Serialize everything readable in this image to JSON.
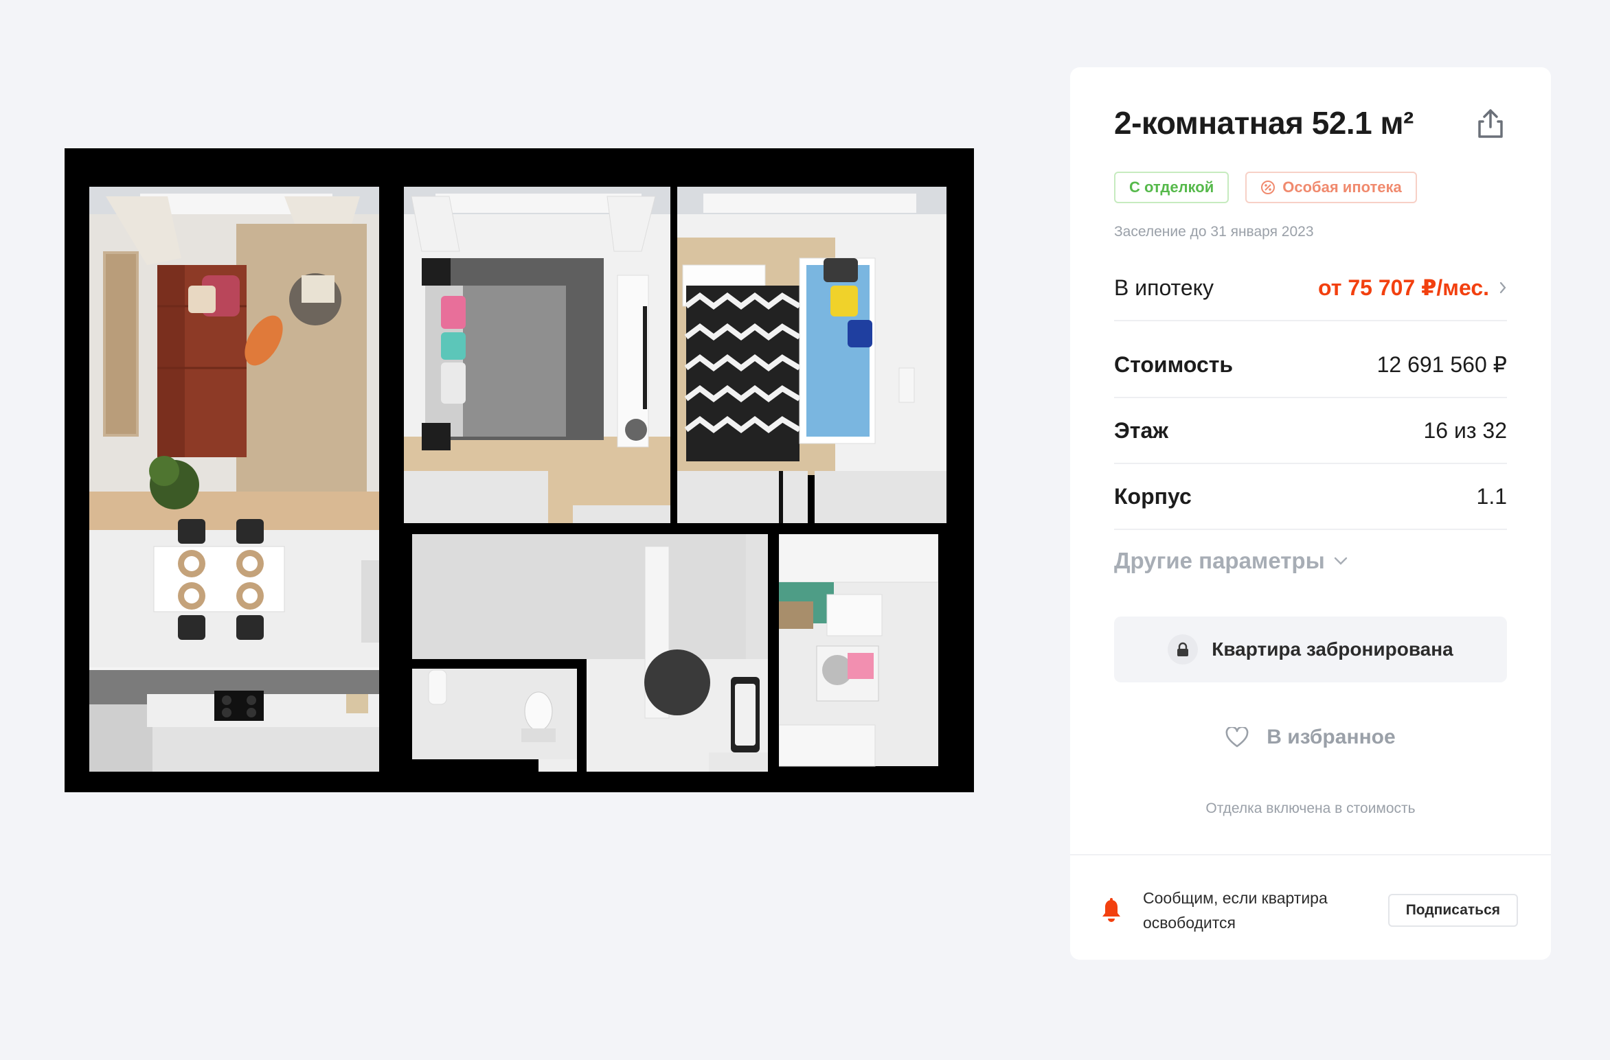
{
  "listing": {
    "title": "2-комнатная 52.1 м²",
    "tags": [
      {
        "label": "С отделкой",
        "color": "#56b94b"
      },
      {
        "label": "Особая ипотека",
        "color": "#f08a6e",
        "icon": "percent-icon"
      }
    ],
    "settlement": "Заселение до 31 января 2023",
    "mortgage": {
      "label": "В ипотеку",
      "value": "от 75 707 ₽/мес."
    },
    "params": [
      {
        "label": "Стоимость",
        "value": "12 691 560 ₽"
      },
      {
        "label": "Этаж",
        "value": "16 из 32"
      },
      {
        "label": "Корпус",
        "value": "1.1"
      }
    ],
    "other_params_label": "Другие параметры",
    "booked_label": "Квартира забронирована",
    "favorite_label": "В избранное",
    "finish_note": "Отделка включена в стоимость",
    "notify": {
      "text": "Сообщим, если квартира освободится",
      "button": "Подписаться"
    }
  },
  "colors": {
    "accent": "#f2400f",
    "background": "#f3f4f8",
    "muted": "#9aa0a8"
  },
  "icons": {
    "share": "share-icon",
    "chevron_right": "chevron-right-icon",
    "chevron_down": "chevron-down-icon",
    "lock": "lock-icon",
    "heart": "heart-icon",
    "bell": "bell-icon"
  }
}
